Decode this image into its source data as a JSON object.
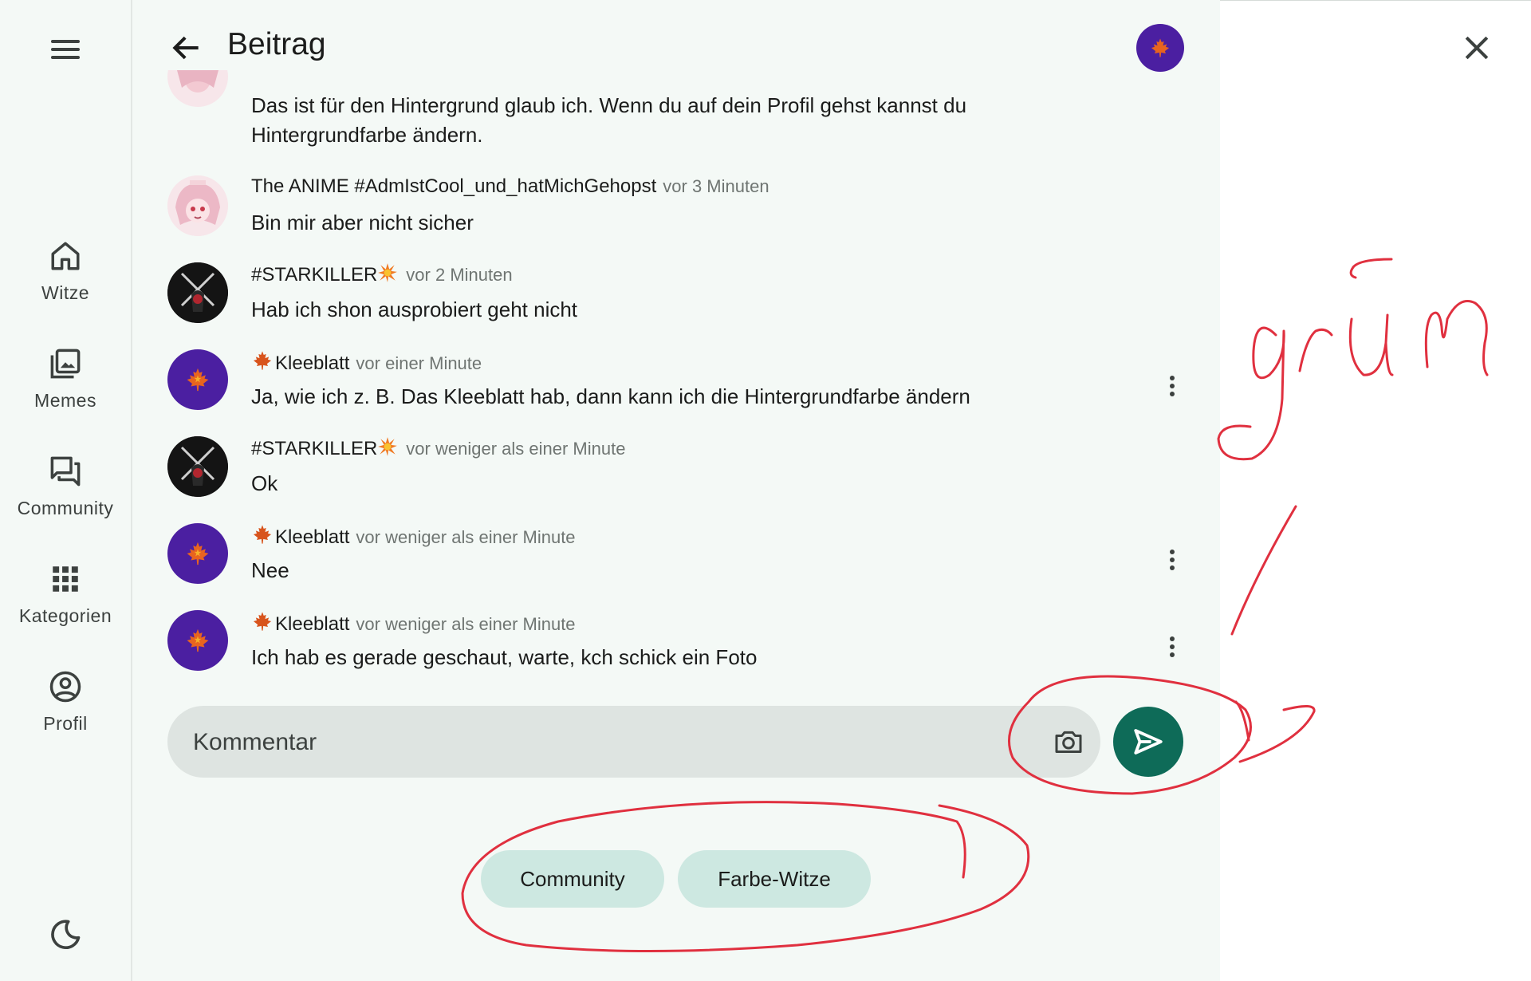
{
  "nav": {
    "items": [
      {
        "label": "Witze",
        "icon": "home-icon"
      },
      {
        "label": "Memes",
        "icon": "image-gallery-icon"
      },
      {
        "label": "Community",
        "icon": "forum-icon"
      },
      {
        "label": "Kategorien",
        "icon": "apps-grid-icon"
      },
      {
        "label": "Profil",
        "icon": "account-circle-icon"
      }
    ],
    "theme_icon": "moon-icon",
    "menu_icon": "hamburger-menu-icon"
  },
  "header": {
    "title": "Beitrag",
    "back_icon": "arrow-back-icon"
  },
  "comments": [
    {
      "author": "",
      "time": "",
      "text": "Das ist für den Hintergrund glaub ich. Wenn du auf dein Profil gehst kannst du Hintergrundfarbe ändern.",
      "avatar": "anime"
    },
    {
      "author": "The ANIME #AdmIstCool_und_hatMichGehopst",
      "time": "vor 3 Minuten",
      "text": "Bin mir aber nicht sicher",
      "avatar": "anime"
    },
    {
      "author": "#STARKILLER",
      "time": "vor 2 Minuten",
      "text": "Hab ich shon ausprobiert geht nicht",
      "avatar": "starkiller"
    },
    {
      "author": "Kleeblatt",
      "time": "vor einer Minute",
      "text": "Ja, wie ich z. B. Das Kleeblatt hab, dann kann ich die Hintergrundfarbe ändern",
      "avatar": "leaf"
    },
    {
      "author": "#STARKILLER",
      "time": "vor weniger als einer Minute",
      "text": "Ok",
      "avatar": "starkiller"
    },
    {
      "author": "Kleeblatt",
      "time": "vor weniger als einer Minute",
      "text": "Nee",
      "avatar": "leaf"
    },
    {
      "author": "Kleeblatt",
      "time": "vor weniger als einer Minute",
      "text": "Ich hab es gerade geschaut, warte, kch schick ein Foto",
      "avatar": "leaf"
    }
  ],
  "composer": {
    "placeholder": "Kommentar",
    "camera_icon": "camera-icon",
    "send_icon": "send-icon"
  },
  "chips": [
    "Community",
    "Farbe-Witze"
  ],
  "close_icon": "close-icon",
  "annotation": {
    "handwritten_text": "grün",
    "color": "#e0303f"
  },
  "colors": {
    "accent": "#0e6b58",
    "chip_bg": "#cde8e1",
    "avatar_purple": "#4b1fa1",
    "app_bg": "#f4f9f6"
  }
}
